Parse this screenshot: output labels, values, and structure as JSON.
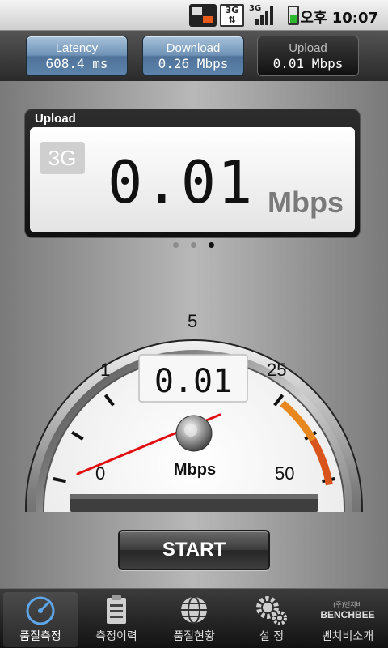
{
  "status_bar": {
    "time": "오후 10:07",
    "network": "3G",
    "icons": [
      "notification-icon",
      "data-3g-icon",
      "signal-icon",
      "battery-icon"
    ]
  },
  "metrics": [
    {
      "label": "Latency",
      "value": "608.4 ms",
      "state": "done"
    },
    {
      "label": "Download",
      "value": "0.26 Mbps",
      "state": "done"
    },
    {
      "label": "Upload",
      "value": "0.01 Mbps",
      "state": "current"
    }
  ],
  "result_panel": {
    "title": "Upload",
    "network_badge": "3G",
    "value": "0.01",
    "unit": "Mbps"
  },
  "page_indicator": {
    "count": 3,
    "active_index": 2
  },
  "gauge": {
    "ticks": [
      "0",
      "1",
      "5",
      "25",
      "50"
    ],
    "digital_readout": "0.01",
    "unit": "Mbps",
    "needle_value": 0.01,
    "max": 50
  },
  "start_button": {
    "label": "START"
  },
  "bottom_nav": {
    "items": [
      {
        "label": "품질측정",
        "icon": "speedometer-icon",
        "active": true
      },
      {
        "label": "측정이력",
        "icon": "clipboard-icon",
        "active": false
      },
      {
        "label": "품질현황",
        "icon": "globe-icon",
        "active": false
      },
      {
        "label": "설 정",
        "icon": "gears-icon",
        "active": false
      },
      {
        "label": "벤치비소개",
        "icon": "benchbee-logo",
        "active": false,
        "logo_text": "BENCHBEE",
        "logo_small": "(주)벤치비"
      }
    ]
  },
  "colors": {
    "accent_blue": "#6e92b6",
    "needle_red": "#e01010",
    "gauge_orange": "#e8871e",
    "gauge_red_orange": "#d9541a"
  }
}
